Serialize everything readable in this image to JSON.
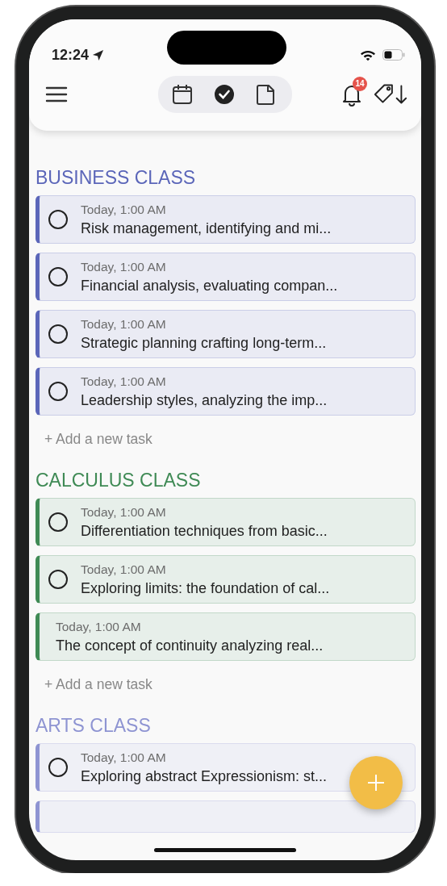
{
  "status_bar": {
    "time": "12:24"
  },
  "toolbar": {
    "tabs": [
      {
        "kind": "calendar",
        "selected": false
      },
      {
        "kind": "tasks",
        "selected": true
      },
      {
        "kind": "notes",
        "selected": false
      }
    ],
    "notification_badge": "14"
  },
  "sections": [
    {
      "title": "BUSINESS CLASS",
      "color": "#5b66b9",
      "tasks": [
        {
          "kind": "checkbox",
          "checked": false,
          "time": "Today, 1:00 AM",
          "title": "Risk management, identifying and mi..."
        },
        {
          "kind": "checkbox",
          "checked": false,
          "time": "Today, 1:00 AM",
          "title": "Financial analysis, evaluating compan..."
        },
        {
          "kind": "checkbox",
          "checked": false,
          "time": "Today, 1:00 AM",
          "title": "Strategic planning crafting long-term..."
        },
        {
          "kind": "checkbox",
          "checked": false,
          "time": "Today, 1:00 AM",
          "title": "Leadership styles, analyzing the imp..."
        }
      ],
      "add_task": "+ Add a new task"
    },
    {
      "title": "CALCULUS CLASS",
      "color": "#3f8a55",
      "tasks": [
        {
          "kind": "checkbox",
          "checked": false,
          "time": "Today, 1:00 AM",
          "title": "Differentiation techniques from basic..."
        },
        {
          "kind": "checkbox",
          "checked": false,
          "time": "Today, 1:00 AM",
          "title": "Exploring limits: the foundation of cal..."
        },
        {
          "kind": "plain",
          "time": "Today, 1:00 AM",
          "title": "The concept of continuity analyzing real..."
        }
      ],
      "add_task": "+ Add a new task"
    },
    {
      "title": "ARTS CLASS",
      "color": "#8e94d2",
      "tasks": [
        {
          "kind": "checkbox",
          "checked": false,
          "time": "Today, 1:00 AM",
          "title": "Exploring abstract Expressionism: st..."
        },
        {
          "kind": "cut"
        }
      ]
    }
  ]
}
